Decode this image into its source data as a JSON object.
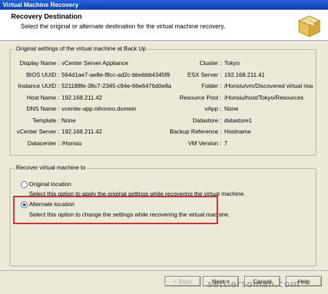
{
  "window": {
    "title": "Virtual Machine Recovery"
  },
  "header": {
    "title": "Recovery Destination",
    "subtitle": "Select the original or alternate destination for the virtual machine recovery."
  },
  "original_settings": {
    "legend": "Original settings of the virtual machine at Back Up",
    "left": [
      {
        "label": "Display Name :",
        "value": "vCenter Server Appliance"
      },
      {
        "label": "BIOS UUID :",
        "value": "564d1ae7-ae8e-f8cc-ad2c-bbebbb4345f9"
      },
      {
        "label": "Instance UUID :",
        "value": "521188fe-38c7-2345-c94e-66e6476d0e8a"
      },
      {
        "label": "Host Name :",
        "value": "192.168.211.42"
      },
      {
        "label": "DNS Name :",
        "value": "vcenter-app.nihonno.domein"
      },
      {
        "label": "Template :",
        "value": "None"
      },
      {
        "label": "vCenter Server :",
        "value": "192.168.211.42"
      },
      {
        "label": "Datacenter :",
        "value": "/Honsiu"
      }
    ],
    "right": [
      {
        "label": "Cluster :",
        "value": "Tokyo"
      },
      {
        "label": "ESX Server :",
        "value": "192.168.211.41"
      },
      {
        "label": "Folder :",
        "value": "/Honsiu/vm/Discovered virtual machi..."
      },
      {
        "label": "Resource Pool :",
        "value": "/Honsiu/host/Tokyo/Resources"
      },
      {
        "label": "vApp :",
        "value": "None"
      },
      {
        "label": "Datastore :",
        "value": "datastore1"
      },
      {
        "label": "Backup Reference :",
        "value": "Hostname"
      },
      {
        "label": "VM Version :",
        "value": "7"
      }
    ]
  },
  "recover_to": {
    "legend": "Recover virtual machine to",
    "options": [
      {
        "label": "Original location",
        "description": "Select this option to apply the original settings while recovering the virtual machine.",
        "selected": false
      },
      {
        "label": "Alternate location",
        "description": "Select this option to change the settings while recovering the virtual machine.",
        "selected": true
      }
    ]
  },
  "buttons": {
    "back": "< Back",
    "next": "Next >",
    "cancel": "Cancel",
    "help": "Help"
  },
  "watermark": "settlersoman.com",
  "colors": {
    "highlight_box": "#d9252c",
    "titlebar": "#0a3fb0"
  }
}
